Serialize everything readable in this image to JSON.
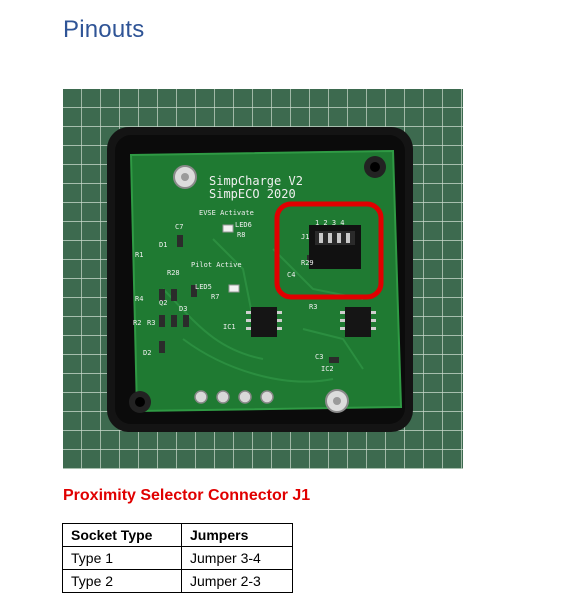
{
  "page": {
    "heading": "Pinouts",
    "heading_color": "#2f5496"
  },
  "photo": {
    "board_line1": "SimpCharge V2",
    "board_line2": "SimpECO 2020",
    "silk_evse": "EVSE Activate",
    "silk_pilot": "Pilot Active",
    "silk_led6": "LED6",
    "silk_led5": "LED5",
    "silk_r8": "R8",
    "silk_r7": "R7",
    "silk_j1": "J1",
    "silk_pins": "1 2 3 4",
    "silk_r29": "R29",
    "silk_c4": "C4",
    "silk_ic1": "IC1",
    "silk_ic2": "IC2",
    "silk_c7": "C7",
    "silk_d1": "D1",
    "silk_r1": "R1",
    "silk_r28": "R28",
    "silk_q2": "Q2",
    "silk_d3": "D3",
    "silk_r2": "R2",
    "silk_r3": "R3",
    "silk_r4": "R4",
    "silk_d2": "D2",
    "silk_c3": "C3",
    "silk_r3b": "R3",
    "highlight_color": "#e00000"
  },
  "section": {
    "title": "Proximity Selector Connector J1",
    "title_color": "#e00000"
  },
  "table": {
    "headers": [
      "Socket Type",
      "Jumpers"
    ],
    "rows": [
      [
        "Type 1",
        "Jumper 3-4"
      ],
      [
        "Type 2",
        "Jumper 2-3"
      ]
    ]
  }
}
